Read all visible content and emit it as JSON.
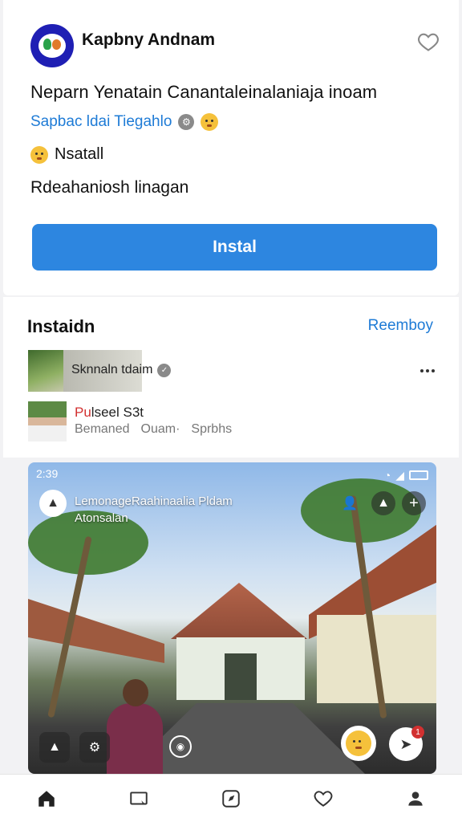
{
  "app": {
    "name": "Kapbny Andnam",
    "headline": "Neparn Yenatain Canantaleinalaniaja inoam",
    "subline": "Sapbac ldai Tiegahlo",
    "line3": "Nsatall",
    "line4": "Rdeahaniosh linagan",
    "install_label": "Instal"
  },
  "section": {
    "title": "Instaidn",
    "link": "Reemboy",
    "items": [
      {
        "label": "Sknnaln tdaim"
      },
      {
        "title_accent": "Pu",
        "title": "lseel S3t",
        "meta": [
          "Bemaned",
          "Ouam·",
          "Sprbhs"
        ]
      }
    ]
  },
  "photo_post": {
    "status_time": "2:39",
    "title_line1": "LemonageRaahinaalia Pldam",
    "title_line2": "Atonsalan",
    "share_badge": "1"
  },
  "tabbar": {
    "items": [
      "home-icon",
      "cast-icon",
      "compass-icon",
      "heart-icon",
      "profile-icon"
    ]
  },
  "colors": {
    "accent": "#2d86e0",
    "link": "#1e7bd6",
    "avatar_bg": "#1f1fb4"
  }
}
